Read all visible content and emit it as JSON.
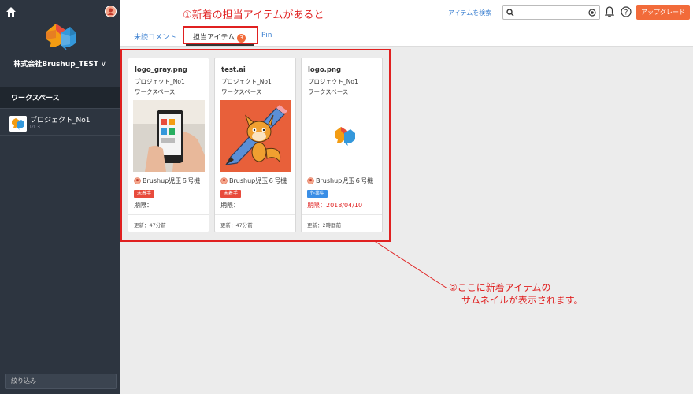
{
  "sidebar": {
    "company": "株式会社Brushup_TEST",
    "workspace_header": "ワークスペース",
    "project": {
      "name": "プロジェクト_No1",
      "count": "3"
    },
    "filter_label": "絞り込み"
  },
  "header": {
    "annotation": "①新着の担当アイテムがあると",
    "search_link": "アイテムを検索",
    "search_value": "",
    "upgrade": "アップグレード"
  },
  "tabs": [
    {
      "label": "未読コメント"
    },
    {
      "label": "担当アイテム",
      "badge": "3"
    },
    {
      "label": "Pin"
    }
  ],
  "cards": [
    {
      "filename": "logo_gray.png",
      "project": "プロジェクト_No1",
      "workspace": "ワークスペース",
      "user": "Brushup児玉６号機",
      "status": "未着手",
      "deadline": "期限：",
      "updated": "更新：47分前"
    },
    {
      "filename": "test.ai",
      "project": "プロジェクト_No1",
      "workspace": "ワークスペース",
      "user": "Brushup児玉６号機",
      "status": "未着手",
      "deadline": "期限：",
      "updated": "更新：47分前"
    },
    {
      "filename": "logo.png",
      "project": "プロジェクト_No1",
      "workspace": "ワークスペース",
      "user": "Brushup児玉６号機",
      "status": "作業中",
      "deadline": "期限：2018/04/10",
      "updated": "更新：2時間前"
    }
  ],
  "annotation2": {
    "line1": "②ここに新着アイテムの",
    "line2": "サムネイルが表示されます。"
  },
  "colors": {
    "accent": "#f26b3a",
    "link": "#3a7fd0",
    "annotation": "#e02020",
    "sidebar": "#2d3540",
    "status_todo": "#e84b3c",
    "status_working": "#3a8ee6"
  }
}
